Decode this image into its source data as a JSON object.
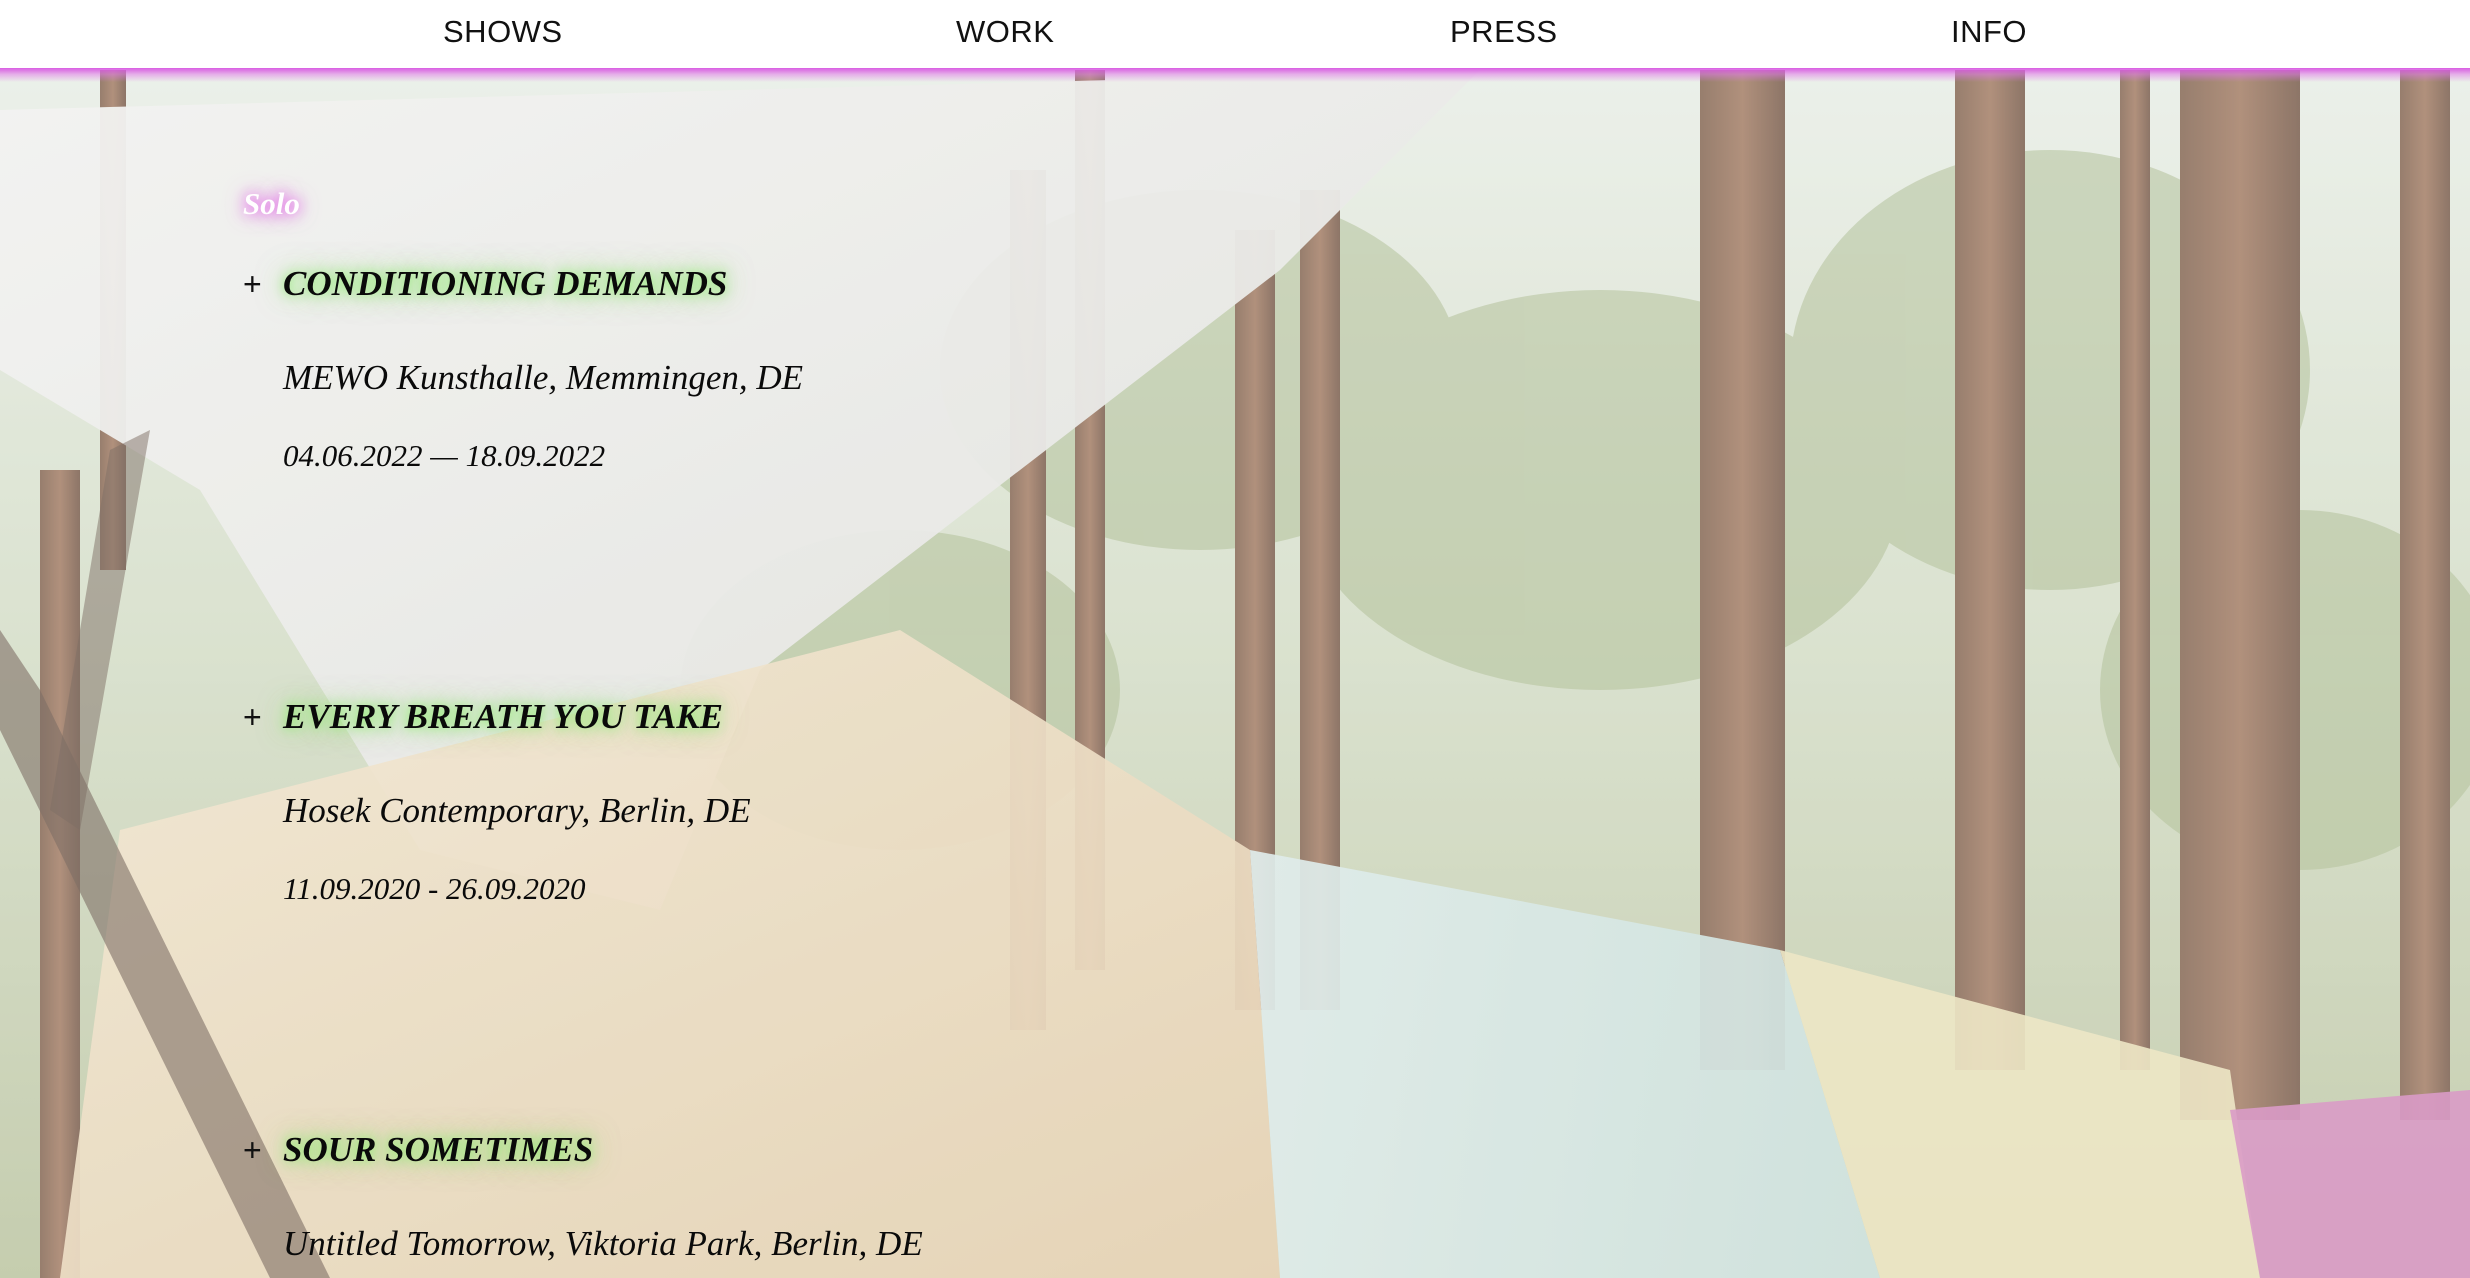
{
  "nav": {
    "items": [
      {
        "label": "SHOWS"
      },
      {
        "label": "WORK"
      },
      {
        "label": "PRESS"
      },
      {
        "label": "INFO"
      }
    ]
  },
  "colors": {
    "nav_glow": "#d654e0",
    "title_glow": "#96eb78",
    "label_glow": "#e25ae8"
  },
  "section": {
    "label": "Solo"
  },
  "shows": [
    {
      "expand_icon": "+",
      "title": "CONDITIONING DEMANDS",
      "venue": "MEWO Kunsthalle, Memmingen, DE",
      "dates": "04.06.2022 — 18.09.2022"
    },
    {
      "expand_icon": "+",
      "title": "EVERY BREATH YOU TAKE",
      "venue": "Hosek Contemporary, Berlin, DE",
      "dates": "11.09.2020 - 26.09.2020"
    },
    {
      "expand_icon": "+",
      "title": "SOUR SOMETIMES",
      "venue": "Untitled Tomorrow, Viktoria Park, Berlin, DE",
      "dates": ""
    }
  ]
}
